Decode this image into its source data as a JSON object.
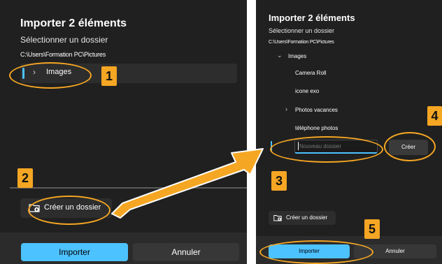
{
  "left_dialog": {
    "title": "Importer 2 éléments",
    "subtitle": "Sélectionner un dossier",
    "path": "C:\\Users\\Formation PC\\Pictures",
    "tree": [
      {
        "label": "Images",
        "expanded": false,
        "selected": true
      }
    ],
    "create_folder_label": "Créer un dossier",
    "import_label": "Importer",
    "cancel_label": "Annuler"
  },
  "right_dialog": {
    "title": "Importer 2 éléments",
    "subtitle": "Sélectionner un dossier",
    "path": "C:\\Users\\Formation PC\\Pictures",
    "tree": [
      {
        "label": "Images",
        "chevron": "down",
        "level": 0
      },
      {
        "label": "Camera Roll",
        "chevron": "",
        "level": 1
      },
      {
        "label": "icone exo",
        "chevron": "",
        "level": 1
      },
      {
        "label": "Photos vacances",
        "chevron": "right",
        "level": 1
      },
      {
        "label": "téléphone photos",
        "chevron": "",
        "level": 1
      }
    ],
    "new_folder_placeholder": "Nouveau dossier",
    "create_button_label": "Créer",
    "create_folder_label": "Créer un dossier",
    "import_label": "Importer",
    "cancel_label": "Annuler"
  },
  "annotations": {
    "step1": "1",
    "step2": "2",
    "step3": "3",
    "step4": "4",
    "step5": "5"
  },
  "colors": {
    "accent": "#4cc2ff",
    "annotation": "#f5a623",
    "dialog_bg": "#202020"
  },
  "icons": {
    "chevron_right": "›",
    "chevron_down": "⌄",
    "new_folder": "folder-add-icon"
  }
}
